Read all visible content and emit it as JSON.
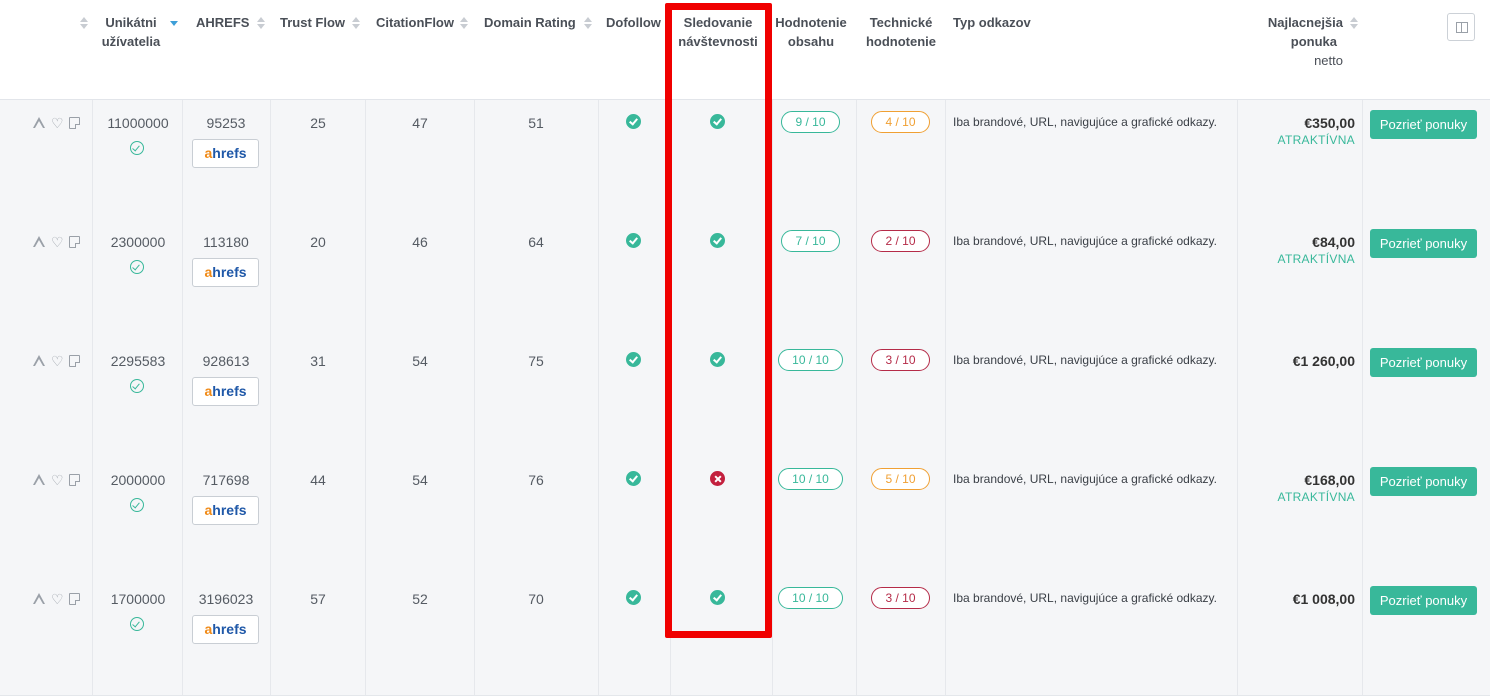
{
  "header": {
    "columns": [
      {
        "key": "unique_users",
        "label_line1": "Unikátni",
        "label_line2": "užívatelia"
      },
      {
        "key": "ahrefs",
        "label_line1": "AHREFS"
      },
      {
        "key": "trust_flow",
        "label_line1": "Trust Flow"
      },
      {
        "key": "citation_flow",
        "label_line1": "CitationFlow"
      },
      {
        "key": "domain_rating",
        "label_line1": "Domain Rating"
      },
      {
        "key": "dofollow",
        "label_line1": "Dofollow"
      },
      {
        "key": "tracking",
        "label_line1": "Sledovanie",
        "label_line2": "návštevnosti"
      },
      {
        "key": "content_rating",
        "label_line1": "Hodnotenie",
        "label_line2": "obsahu"
      },
      {
        "key": "technical_rating",
        "label_line1": "Technické",
        "label_line2": "hodnotenie"
      },
      {
        "key": "link_type",
        "label_line1": "Typ odkazov"
      },
      {
        "key": "cheapest_offer",
        "label_line1": "Najlacnejšia",
        "label_line2": "ponuka",
        "label_line3": "netto"
      }
    ]
  },
  "ahrefs_logo": {
    "a": "a",
    "rest": "hrefs"
  },
  "rows": [
    {
      "unique_users": "11000000",
      "ahrefs": "95253",
      "trust_flow": "25",
      "citation_flow": "47",
      "domain_rating": "51",
      "dofollow": true,
      "tracking": true,
      "content_rating": "9 / 10",
      "technical_rating": "4 / 10",
      "link_type": "Iba brandové, URL, navigujúce a grafické odkazy.",
      "price": "€350,00",
      "badge": "ATRAKTÍVNA",
      "button": "Pozrieť ponuky"
    },
    {
      "unique_users": "2300000",
      "ahrefs": "113180",
      "trust_flow": "20",
      "citation_flow": "46",
      "domain_rating": "64",
      "dofollow": true,
      "tracking": true,
      "content_rating": "7 / 10",
      "technical_rating": "2 / 10",
      "link_type": "Iba brandové, URL, navigujúce a grafické odkazy.",
      "price": "€84,00",
      "badge": "ATRAKTÍVNA",
      "button": "Pozrieť ponuky"
    },
    {
      "unique_users": "2295583",
      "ahrefs": "928613",
      "trust_flow": "31",
      "citation_flow": "54",
      "domain_rating": "75",
      "dofollow": true,
      "tracking": true,
      "content_rating": "10 / 10",
      "technical_rating": "3 / 10",
      "link_type": "Iba brandové, URL, navigujúce a grafické odkazy.",
      "price": "€1 260,00",
      "badge": "",
      "button": "Pozrieť ponuky"
    },
    {
      "unique_users": "2000000",
      "ahrefs": "717698",
      "trust_flow": "44",
      "citation_flow": "54",
      "domain_rating": "76",
      "dofollow": true,
      "tracking": false,
      "content_rating": "10 / 10",
      "technical_rating": "5 / 10",
      "link_type": "Iba brandové, URL, navigujúce a grafické odkazy.",
      "price": "€168,00",
      "badge": "ATRAKTÍVNA",
      "button": "Pozrieť ponuky"
    },
    {
      "unique_users": "1700000",
      "ahrefs": "3196023",
      "trust_flow": "57",
      "citation_flow": "52",
      "domain_rating": "70",
      "dofollow": true,
      "tracking": true,
      "content_rating": "10 / 10",
      "technical_rating": "3 / 10",
      "link_type": "Iba brandové, URL, navigujúce a grafické odkazy.",
      "price": "€1 008,00",
      "badge": "",
      "button": "Pozrieť ponuky"
    }
  ],
  "colors": {
    "accent_green": "#38b89a",
    "warning_orange": "#f0a033",
    "danger_red": "#b52b48",
    "highlight_red": "#f00000"
  },
  "icons": {
    "row_actions": [
      "warning-icon",
      "heart-icon",
      "note-icon"
    ],
    "verified": "verified-check-icon",
    "yes": "check-circle-icon",
    "no": "x-circle-icon",
    "column_settings": "columns-icon"
  }
}
